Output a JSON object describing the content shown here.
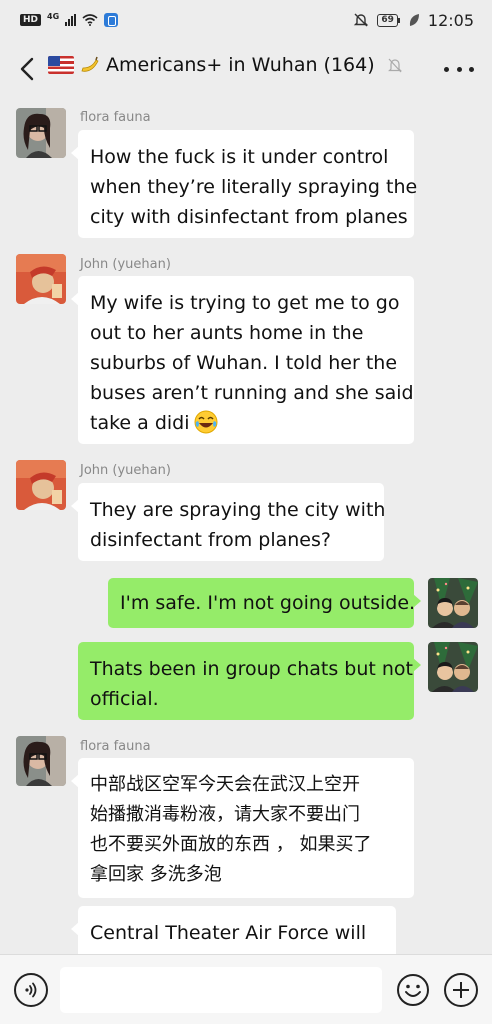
{
  "status_bar": {
    "hd": "HD",
    "network": "4G",
    "battery": "69",
    "time": "12:05"
  },
  "header": {
    "title": "Americans+ in Wuhan (164)",
    "flag_icon": "us-flag-icon",
    "banana_icon": "banana-icon"
  },
  "messages": [
    {
      "sender": "flora fauna",
      "lines": [
        "How the fuck is it under control",
        "when they’re literally spraying the",
        "city with disinfectant from planes"
      ]
    },
    {
      "sender": "John (yuehan)",
      "lines": [
        "My wife is trying to get me to go",
        "out to her aunts home in the",
        "suburbs of Wuhan. I told her the",
        "buses aren’t running and she said",
        "take a didi"
      ]
    },
    {
      "sender": "John (yuehan)",
      "lines": [
        "They are spraying the city with",
        "disinfectant from planes?"
      ]
    },
    {
      "sender": "",
      "lines": [
        "I'm safe. I'm not going outside."
      ]
    },
    {
      "sender": "",
      "lines": [
        "Thats been in group chats but not",
        "official."
      ]
    },
    {
      "sender": "flora fauna",
      "lines": [
        "中部战区空军今天会在武汉上空开",
        "始播撒消毒粉液，请大家不要出门",
        "也不要买外面放的东西 ， 如果买了",
        "拿回家 多洗多泡"
      ]
    },
    {
      "sender": "",
      "lines": [
        "Central Theater Air Force will"
      ]
    }
  ],
  "input": {
    "placeholder": ""
  }
}
